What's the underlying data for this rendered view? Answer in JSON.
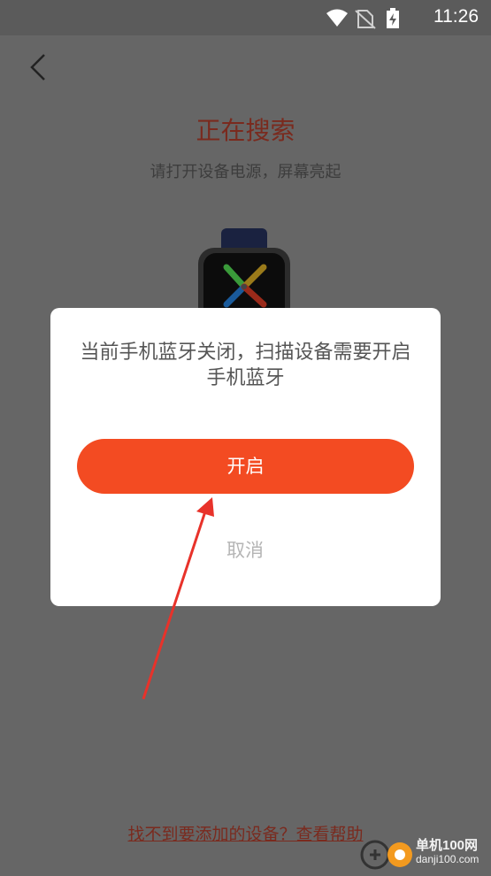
{
  "status_bar": {
    "time": "11:26"
  },
  "page": {
    "title": "正在搜索",
    "subtitle": "请打开设备电源，屏幕亮起",
    "help_link": "找不到要添加的设备？查看帮助"
  },
  "dialog": {
    "message": "当前手机蓝牙关闭，扫描设备需要开启手机蓝牙",
    "open_label": "开启",
    "cancel_label": "取消"
  },
  "watermark": {
    "name": "单机100网",
    "url": "danji100.com"
  },
  "colors": {
    "accent": "#f34b22",
    "title": "#7a2a1e",
    "overlay": "#666666"
  },
  "icons": [
    "wifi-icon",
    "no-sim-icon",
    "battery-charging-icon",
    "back-arrow-icon",
    "smartwatch-icon"
  ]
}
